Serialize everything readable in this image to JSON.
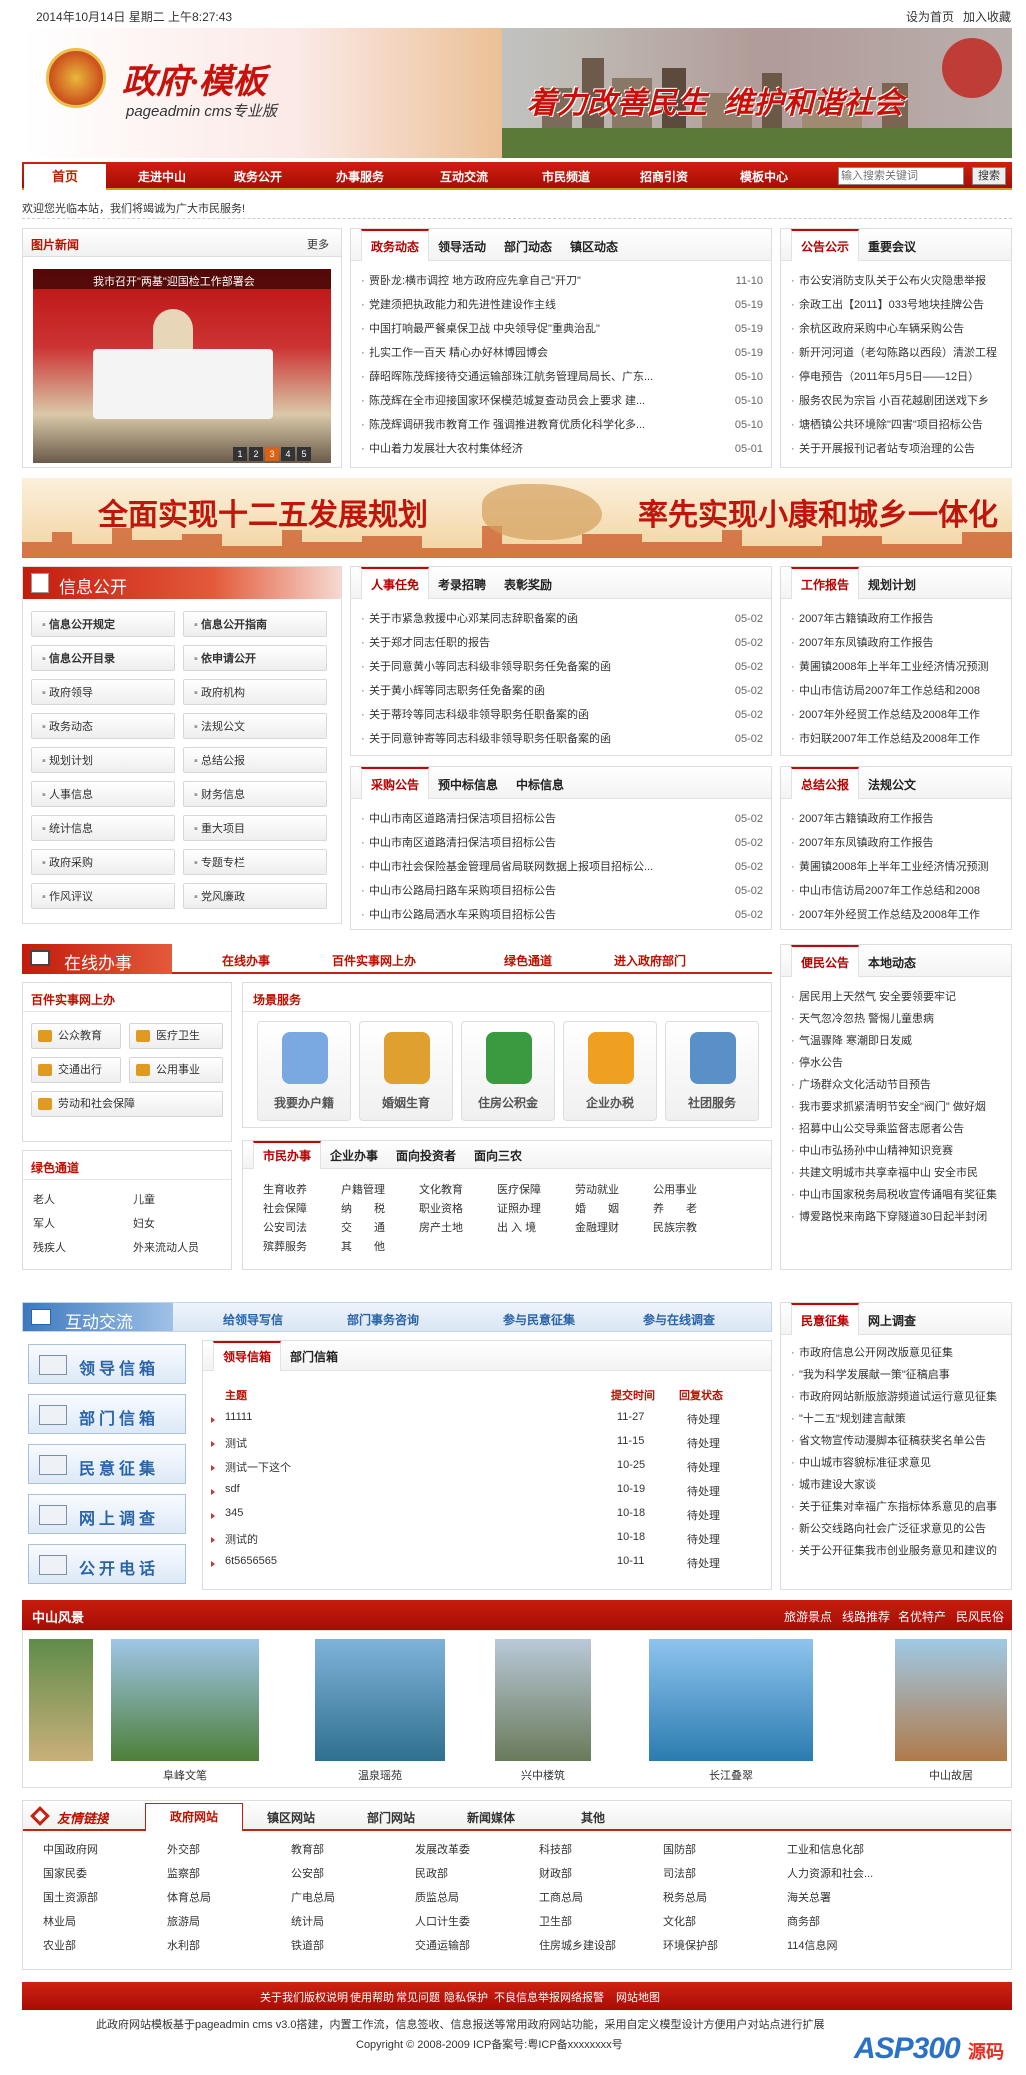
{
  "topbar": {
    "datetime": "2014年10月14日 星期二 上午8:27:43",
    "set_home": "设为首页",
    "add_fav": "加入收藏"
  },
  "banner": {
    "site_title": "政府·模板",
    "site_sub": "pageadmin cms专业版",
    "slogan": "着力改善民生  维护和谐社会"
  },
  "nav": {
    "items": [
      "首页",
      "走进中山",
      "政务公开",
      "办事服务",
      "互动交流",
      "市民频道",
      "招商引资",
      "模板中心"
    ],
    "search_placeholder": "输入搜索关键词",
    "search_btn": "搜索"
  },
  "welcome": "欢迎您光临本站，我们将竭诚为广大市民服务!",
  "picnews": {
    "title": "图片新闻",
    "more": "更多",
    "caption": "我市召开\"两基\"迎国检工作部署会",
    "pages": [
      "1",
      "2",
      "3",
      "4",
      "5"
    ]
  },
  "govnews": {
    "tabs": [
      "政务动态",
      "领导活动",
      "部门动态",
      "镇区动态"
    ],
    "items": [
      {
        "t": "贾卧龙:横市调控 地方政府应先拿自己\"开刀\"",
        "d": "11-10"
      },
      {
        "t": "党建须把执政能力和先进性建设作主线",
        "d": "05-19"
      },
      {
        "t": "中国打响最严餐桌保卫战 中央领导促\"重典治乱\"",
        "d": "05-19"
      },
      {
        "t": "扎实工作一百天 精心办好林博园博会",
        "d": "05-19"
      },
      {
        "t": "薛昭晖陈茂辉接待交通运输部珠江航务管理局局长、广东...",
        "d": "05-10"
      },
      {
        "t": "陈茂辉在全市迎接国家环保模范城复查动员会上要求 建...",
        "d": "05-10"
      },
      {
        "t": "陈茂辉调研我市教育工作 强调推进教育优质化科学化多...",
        "d": "05-10"
      },
      {
        "t": "中山着力发展壮大农村集体经济",
        "d": "05-01"
      }
    ]
  },
  "notice": {
    "tabs": [
      "公告公示",
      "重要会议"
    ],
    "items": [
      "市公安消防支队关于公布火灾隐患举报",
      "余政工出【2011】033号地块挂牌公告",
      "余杭区政府采购中心车辆采购公告",
      "新开河河道（老勾陈路以西段）清淤工程",
      "停电预告（2011年5月5日——12日）",
      "服务农民为宗旨 小百花越剧团送戏下乡",
      "塘栖镇公共环境除\"四害\"项目招标公告",
      "关于开展报刊记者站专项治理的公告"
    ]
  },
  "ad": {
    "left": "全面实现十二五发展规划",
    "right": "率先实现小康和城乡一体化"
  },
  "info": {
    "title": "信息公开",
    "buttons": [
      "信息公开规定",
      "信息公开指南",
      "信息公开目录",
      "依申请公开",
      "政府领导",
      "政府机构",
      "政务动态",
      "法规公文",
      "规划计划",
      "总结公报",
      "人事信息",
      "财务信息",
      "统计信息",
      "重大项目",
      "政府采购",
      "专题专栏",
      "作风评议",
      "党风廉政"
    ]
  },
  "personnel": {
    "tabs": [
      "人事任免",
      "考录招聘",
      "表彰奖励"
    ],
    "items": [
      {
        "t": "关于市紧急救援中心邓某同志辞职备案的函",
        "d": "05-02"
      },
      {
        "t": "关于郑才同志任职的报告",
        "d": "05-02"
      },
      {
        "t": "关于同意黄小等同志科级非领导职务任免备案的函",
        "d": "05-02"
      },
      {
        "t": "关于黄小辉等同志职务任免备案的函",
        "d": "05-02"
      },
      {
        "t": "关于蒂玲等同志科级非领导职务任职备案的函",
        "d": "05-02"
      },
      {
        "t": "关于同意钟寄等同志科级非领导职务任职备案的函",
        "d": "05-02"
      }
    ]
  },
  "workreport": {
    "tabs": [
      "工作报告",
      "规划计划"
    ],
    "items": [
      "2007年古籍镇政府工作报告",
      "2007年东凤镇政府工作报告",
      "黄圃镇2008年上半年工业经济情况预测",
      "中山市信访局2007年工作总结和2008",
      "2007年外经贸工作总结及2008年工作",
      "市妇联2007年工作总结及2008年工作"
    ]
  },
  "purchase": {
    "tabs": [
      "采购公告",
      "预中标信息",
      "中标信息"
    ],
    "items": [
      {
        "t": "中山市南区道路清扫保洁项目招标公告",
        "d": "05-02"
      },
      {
        "t": "中山市南区道路清扫保洁项目招标公告",
        "d": "05-02"
      },
      {
        "t": "中山市社会保险基金管理局省局联网数据上报项目招标公...",
        "d": "05-02"
      },
      {
        "t": "中山市公路局扫路车采购项目招标公告",
        "d": "05-02"
      },
      {
        "t": "中山市公路局洒水车采购项目招标公告",
        "d": "05-02"
      }
    ]
  },
  "summary": {
    "tabs": [
      "总结公报",
      "法规公文"
    ],
    "items": [
      "2007年古籍镇政府工作报告",
      "2007年东凤镇政府工作报告",
      "黄圃镇2008年上半年工业经济情况预测",
      "中山市信访局2007年工作总结和2008",
      "2007年外经贸工作总结及2008年工作"
    ]
  },
  "online": {
    "title": "在线办事",
    "links": [
      "在线办事",
      "百件实事网上办",
      "绿色通道",
      "进入政府部门"
    ],
    "shijian_title": "百件实事网上办",
    "shijian": [
      "公众教育",
      "医疗卫生",
      "交通出行",
      "公用事业",
      "劳动和社会保障"
    ],
    "green_title": "绿色通道",
    "green": [
      "老人",
      "儿童",
      "军人",
      "妇女",
      "残疾人",
      "外来流动人员"
    ],
    "scene_title": "场景服务",
    "scenes": [
      "我要办户籍",
      "婚姻生育",
      "住房公积金",
      "企业办税",
      "社团服务"
    ],
    "citizen_tabs": [
      "市民办事",
      "企业办事",
      "面向投资者",
      "面向三农"
    ],
    "citizen_grid": [
      "生育收养",
      "户籍管理",
      "文化教育",
      "医疗保障",
      "劳动就业",
      "公用事业",
      "社会保障",
      "纳　　税",
      "职业资格",
      "证照办理",
      "婚　　姻",
      "养　　老",
      "公安司法",
      "交　　通",
      "房产土地",
      "出 入 境",
      "金融理财",
      "民族宗教",
      "殡葬服务",
      "其　　他"
    ]
  },
  "convenience": {
    "tabs": [
      "便民公告",
      "本地动态"
    ],
    "items": [
      "居民用上天然气 安全要领要牢记",
      "天气忽冷忽热 警惕儿童患病",
      "气温骤降 寒潮即日发威",
      "停水公告",
      "广场群众文化活动节目预告",
      "我市要求抓紧清明节安全\"阀门\" 做好烟",
      "招募中山公交导乘监督志愿者公告",
      "中山市弘扬孙中山精神知识竞赛",
      "共建文明城市共享幸福中山 安全市民",
      "中山市国家税务局税收宣传诵唱有奖征集",
      "博爱路悦来南路下穿隧道30日起半封闭"
    ]
  },
  "interact": {
    "title": "互动交流",
    "links": [
      "给领导写信",
      "部门事务咨询",
      "参与民意征集",
      "参与在线调查"
    ],
    "side": [
      "领导信箱",
      "部门信箱",
      "民意征集",
      "网上调查",
      "公开电话"
    ],
    "tabs": [
      "领导信箱",
      "部门信箱"
    ],
    "cols": [
      "主题",
      "提交时间",
      "回复状态"
    ],
    "rows": [
      [
        "11111",
        "11-27",
        "待处理"
      ],
      [
        "测试",
        "11-15",
        "待处理"
      ],
      [
        "测试一下这个",
        "10-25",
        "待处理"
      ],
      [
        "sdf",
        "10-19",
        "待处理"
      ],
      [
        "345",
        "10-18",
        "待处理"
      ],
      [
        "测试的",
        "10-18",
        "待处理"
      ],
      [
        "6t5656565",
        "10-11",
        "待处理"
      ]
    ]
  },
  "poll": {
    "tabs": [
      "民意征集",
      "网上调查"
    ],
    "items": [
      "市政府信息公开网改版意见征集",
      "\"我为科学发展献一策\"征稿启事",
      "市政府网站新版旅游频道试运行意见征集",
      "\"十二五\"规划建言献策",
      "省文物宣传动漫脚本征稿获奖名单公告",
      "中山城市容貌标准征求意见",
      "城市建设大家谈",
      "关于征集对幸福广东指标体系意见的启事",
      "新公交线路向社会广泛征求意见的公告",
      "关于公开征集我市创业服务意见和建议的"
    ]
  },
  "scenery": {
    "title": "中山风景",
    "links": [
      "旅游景点",
      "线路推荐",
      "名优特产",
      "民风民俗"
    ],
    "photos": [
      "",
      "阜峰文笔",
      "温泉瑶苑",
      "兴中楼筑",
      "长江叠翠",
      "中山故居"
    ]
  },
  "friendlink": {
    "title": "友情链接",
    "tabs": [
      "政府网站",
      "镇区网站",
      "部门网站",
      "新闻媒体",
      "其他"
    ],
    "items": [
      "中国政府网",
      "外交部",
      "教育部",
      "发展改革委",
      "科技部",
      "国防部",
      "工业和信息化部",
      "国家民委",
      "监察部",
      "公安部",
      "民政部",
      "财政部",
      "司法部",
      "人力资源和社会...",
      "国土资源部",
      "体育总局",
      "广电总局",
      "质监总局",
      "工商总局",
      "税务总局",
      "海关总署",
      "林业局",
      "旅游局",
      "统计局",
      "人口计生委",
      "卫生部",
      "文化部",
      "商务部",
      "农业部",
      "水利部",
      "铁道部",
      "交通运输部",
      "住房城乡建设部",
      "环境保护部",
      "114信息网"
    ]
  },
  "footer": {
    "links": [
      "关于我们",
      "版权说明",
      "使用帮助",
      "常见问题",
      "隐私保护",
      "不良信息举报",
      "网络报警",
      "网站地图"
    ],
    "line1": "此政府网站模板基于pageadmin cms v3.0搭建，内置工作流，信息签收、信息报送等常用政府网站功能，采用自定义模型设计方便用户对站点进行扩展",
    "line2": "Copyright © 2008-2009 ICP备案号:粤ICP备xxxxxxxx号",
    "watermark": "ASP300",
    "watermark2": "源码"
  },
  "colors": {
    "primary_red": "#c41a0c",
    "nav_red": "#b5120a",
    "blue": "#2a64a8"
  }
}
